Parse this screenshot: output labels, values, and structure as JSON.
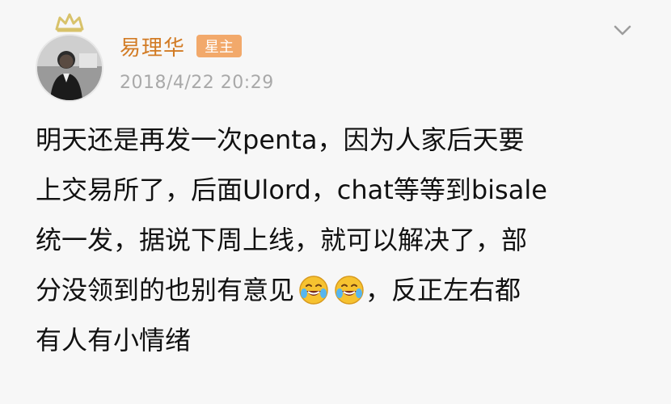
{
  "post": {
    "author": {
      "name": "易理华",
      "badge": "星主",
      "avatar_icon": "avatar-photo-icon",
      "crown_icon": "crown-icon"
    },
    "timestamp": "2018/4/22 20:29",
    "more_icon": "chevron-down-icon",
    "content": {
      "lines": [
        "明天还是再发一次penta，因为人家后天要",
        "上交易所了，后面Ulord，chat等等到bisale",
        "统一发，据说下周上线，就可以解决了，部",
        "分没领到的也别有意见",
        "，反正左右都",
        "有人有小情绪"
      ],
      "emoji": [
        "laughing-tears-emoji",
        "laughing-tears-emoji"
      ]
    }
  },
  "colors": {
    "background": "#f7f7f7",
    "username": "#d27b24",
    "badge_bg": "#f2a96b",
    "timestamp": "#a9a9a9",
    "text": "#111111"
  }
}
